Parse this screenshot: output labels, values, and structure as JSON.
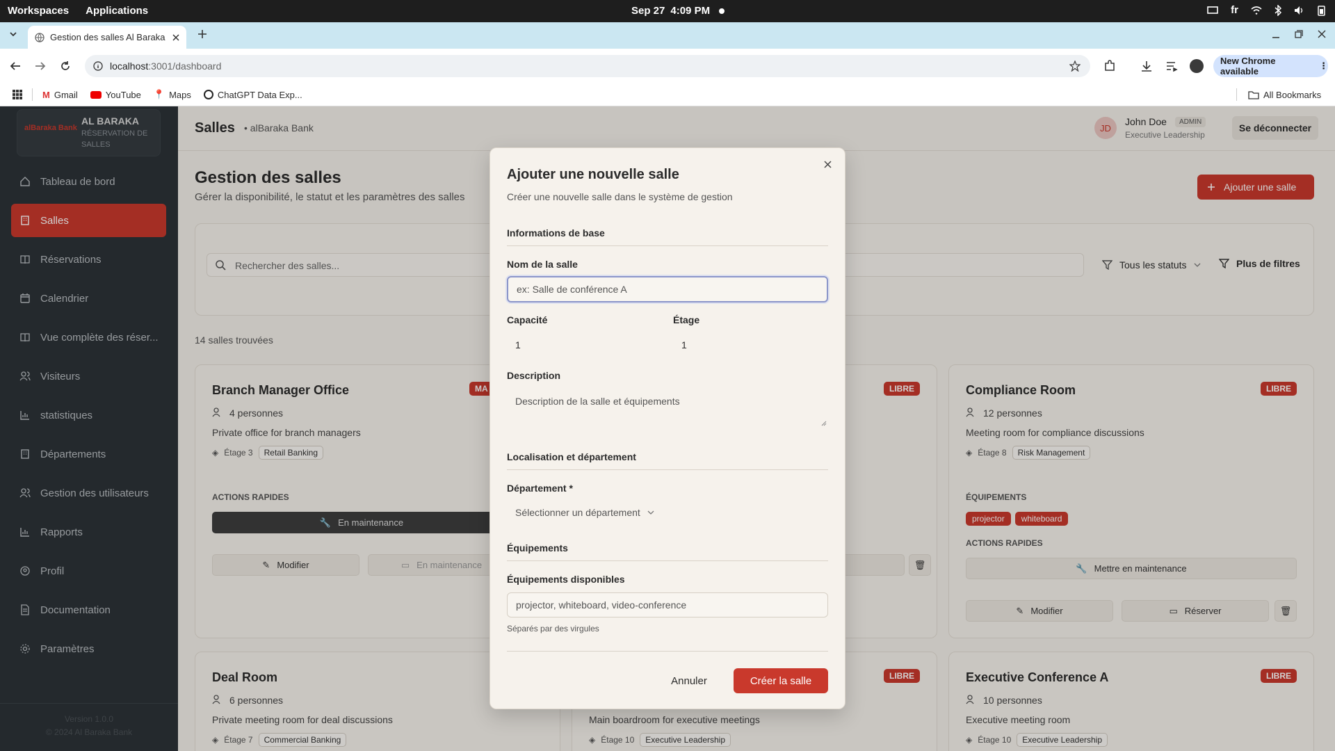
{
  "os": {
    "workspaces": "Workspaces",
    "applications": "Applications",
    "date": "Sep 27",
    "time": "4:09 PM",
    "lang": "fr"
  },
  "browser": {
    "tab_title": "Gestion des salles Al Baraka",
    "url_host": "localhost",
    "url_path": ":3001/dashboard",
    "new_chrome": "New Chrome available",
    "bookmarks": [
      "Gmail",
      "YouTube",
      "Maps",
      "ChatGPT Data Exp..."
    ],
    "all_bookmarks": "All Bookmarks"
  },
  "brand": {
    "name": "AL BARAKA",
    "subtitle": "RÉSERVATION DE SALLES",
    "logo": "alBaraka Bank"
  },
  "sidebar": {
    "items": [
      {
        "label": "Tableau de bord",
        "icon": "home-icon"
      },
      {
        "label": "Salles",
        "icon": "building-icon"
      },
      {
        "label": "Réservations",
        "icon": "book-icon"
      },
      {
        "label": "Calendrier",
        "icon": "calendar-icon"
      },
      {
        "label": "Vue complète des réser...",
        "icon": "book-icon"
      },
      {
        "label": "Visiteurs",
        "icon": "users-icon"
      },
      {
        "label": "statistiques",
        "icon": "chart-icon"
      },
      {
        "label": "Départements",
        "icon": "building-icon"
      },
      {
        "label": "Gestion des utilisateurs",
        "icon": "users-icon"
      },
      {
        "label": "Rapports",
        "icon": "chart-icon"
      },
      {
        "label": "Profil",
        "icon": "profile-icon"
      },
      {
        "label": "Documentation",
        "icon": "doc-icon"
      },
      {
        "label": "Paramètres",
        "icon": "gear-icon"
      }
    ],
    "footer_version": "Version 1.0.0",
    "footer_copy": "© 2024 Al Baraka Bank"
  },
  "header": {
    "title": "Salles",
    "subtitle": "alBaraka Bank",
    "user_initials": "JD",
    "user_name": "John Doe",
    "user_role_badge": "ADMIN",
    "user_department": "Executive Leadership",
    "logout": "Se déconnecter"
  },
  "page": {
    "title": "Gestion des salles",
    "subtitle": "Gérer la disponibilité, le statut et les paramètres des salles",
    "add_button": "Ajouter une salle",
    "search_placeholder": "Rechercher des salles...",
    "status_filter": "Tous les statuts",
    "more_filters": "Plus de filtres",
    "count": "14 salles trouvées"
  },
  "cards": [
    {
      "name": "Branch Manager Office",
      "badge": "MA",
      "capacity": "4 personnes",
      "description": "Private office for branch managers",
      "floor": "Étage 3",
      "department": "Retail Banking",
      "quick_actions": "ACTIONS RAPIDES",
      "maintenance_btn": "En maintenance",
      "edit": "Modifier",
      "disabled_btn": "En maintenance"
    },
    {
      "badge": "LIBRE"
    },
    {
      "name": "Compliance Room",
      "badge": "LIBRE",
      "capacity": "12 personnes",
      "description": "Meeting room for compliance discussions",
      "floor": "Étage 8",
      "department": "Risk Management",
      "equipment_label": "ÉQUIPEMENTS",
      "equipment": [
        "projector",
        "whiteboard"
      ],
      "quick_actions": "ACTIONS RAPIDES",
      "maintenance_btn": "Mettre en maintenance",
      "edit": "Modifier",
      "reserve": "Réserver"
    },
    {
      "name": "Deal Room",
      "capacity": "6 personnes",
      "description": "Private meeting room for deal discussions",
      "floor": "Étage 7",
      "department": "Commercial Banking"
    },
    {
      "badge": "LIBRE",
      "description": "Main boardroom for executive meetings",
      "floor": "Étage 10",
      "department": "Executive Leadership"
    },
    {
      "name": "Executive Conference A",
      "badge": "LIBRE",
      "capacity": "10 personnes",
      "description": "Executive meeting room",
      "floor": "Étage 10",
      "department": "Executive Leadership"
    }
  ],
  "modal": {
    "title": "Ajouter une nouvelle salle",
    "subtitle": "Créer une nouvelle salle dans le système de gestion",
    "section_basic": "Informations de base",
    "name_label": "Nom de la salle",
    "name_placeholder": "ex: Salle de conférence A",
    "capacity_label": "Capacité",
    "capacity_value": "1",
    "floor_label": "Étage",
    "floor_value": "1",
    "description_label": "Description",
    "description_placeholder": "Description de la salle et équipements",
    "section_location": "Localisation et département",
    "department_label": "Département *",
    "department_placeholder": "Sélectionner un département",
    "section_equipment": "Équipements",
    "equipment_label": "Équipements disponibles",
    "equipment_placeholder": "projector, whiteboard, video-conference",
    "equipment_hint": "Séparés par des virgules",
    "cancel": "Annuler",
    "submit": "Créer la salle"
  },
  "colors": {
    "accent": "#c9392c",
    "sidebar": "#2d3338",
    "background": "#f3efe9",
    "modal": "#f6f2ec",
    "focus": "#8b95c9"
  }
}
